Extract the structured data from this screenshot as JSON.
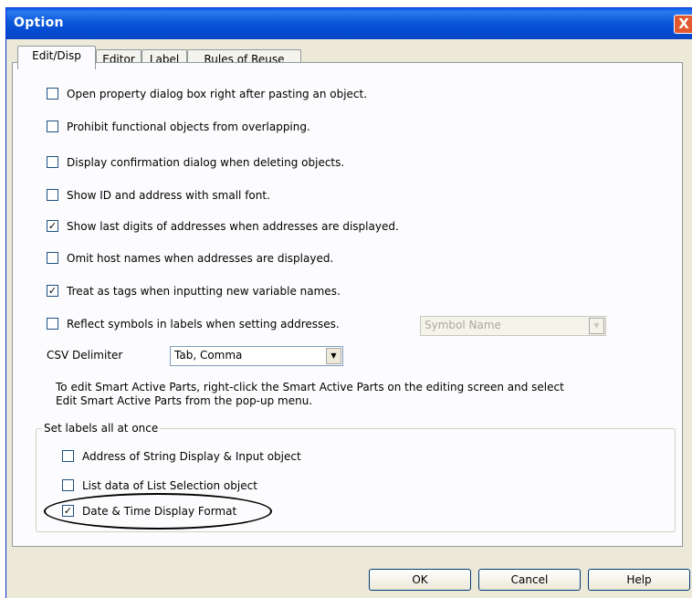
{
  "window": {
    "title": "Option",
    "close_label": "X"
  },
  "tabs": [
    {
      "label": "Edit/Disp",
      "active": true
    },
    {
      "label": "Editor",
      "active": false
    },
    {
      "label": "Label",
      "active": false
    },
    {
      "label": "Rules of Reuse",
      "active": false
    }
  ],
  "options": [
    {
      "label": "Open property dialog box right after pasting an object.",
      "checked": false
    },
    {
      "label": "Prohibit functional objects from overlapping.",
      "checked": false
    },
    {
      "label": "Display confirmation dialog when deleting objects.",
      "checked": false
    },
    {
      "label": "Show ID and address with small font.",
      "checked": false
    },
    {
      "label": "Show last digits of addresses when addresses are displayed.",
      "checked": true
    },
    {
      "label": "Omit host names when addresses are displayed.",
      "checked": false
    },
    {
      "label": "Treat as tags when inputting new variable names.",
      "checked": true
    },
    {
      "label": "Reflect symbols in labels when setting addresses.",
      "checked": false
    }
  ],
  "symbol_select": {
    "value": "Symbol Name",
    "enabled": false
  },
  "csv": {
    "label": "CSV Delimiter",
    "value": "Tab, Comma"
  },
  "note": {
    "line1": "To edit Smart Active Parts, right-click the Smart Active Parts on the editing screen and select",
    "line2": "Edit Smart Active Parts from the pop-up menu."
  },
  "group": {
    "title": "Set labels all at once",
    "items": [
      {
        "label": "Address of String Display & Input object",
        "checked": false
      },
      {
        "label": "List data of List Selection object",
        "checked": false
      },
      {
        "label": "Date & Time Display Format",
        "checked": true
      }
    ]
  },
  "buttons": {
    "ok": "OK",
    "cancel": "Cancel",
    "help": "Help"
  },
  "check_glyph": "✓",
  "colors": {
    "title_bar": "#0a5fe6",
    "window_bg": "#ece9d8",
    "close_button": "#e2582f"
  }
}
